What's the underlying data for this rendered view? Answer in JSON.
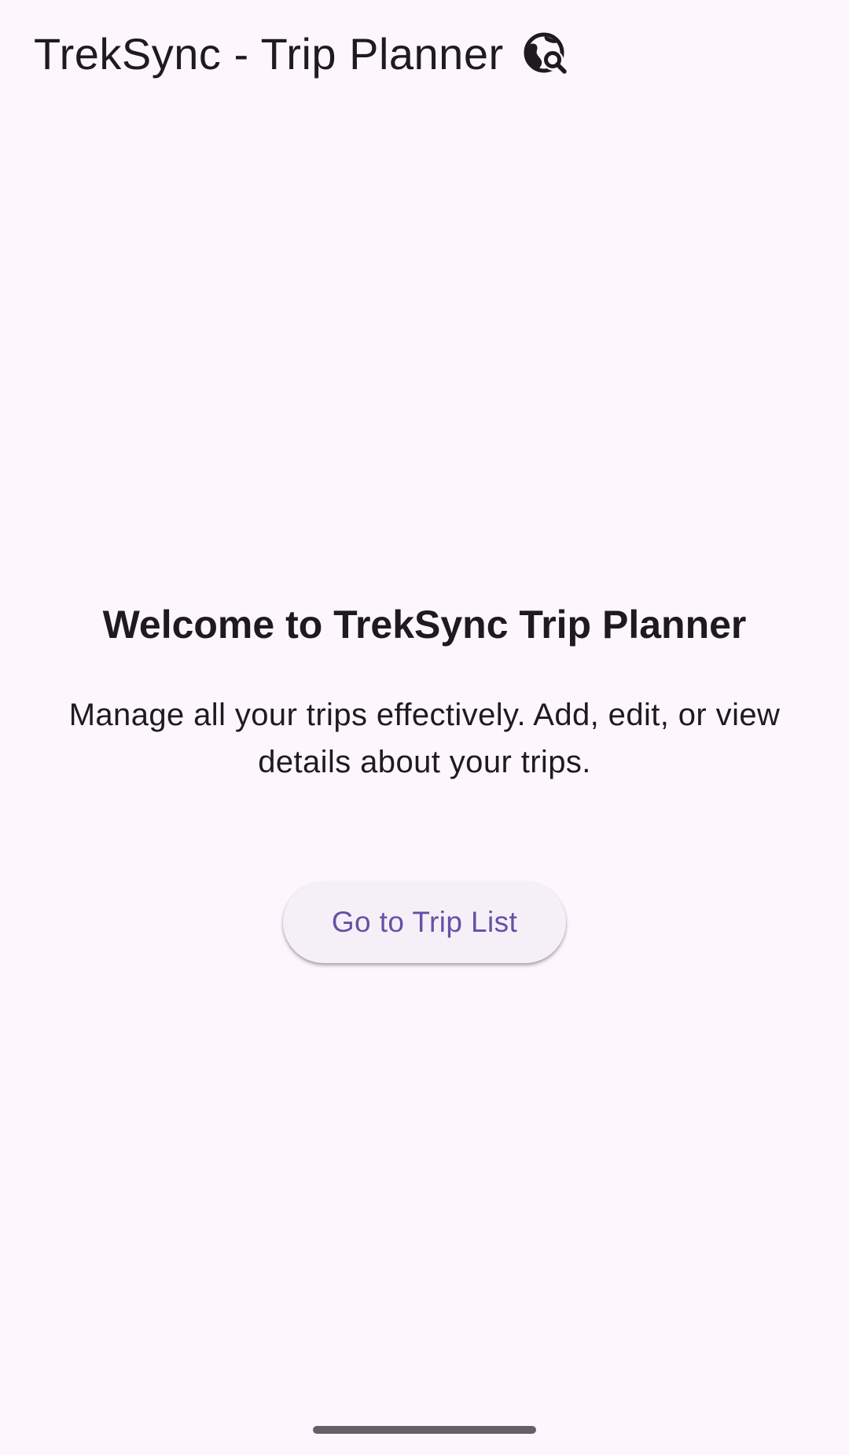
{
  "app_bar": {
    "title": "TrekSync - Trip Planner",
    "icon": "travel-explore-icon"
  },
  "main": {
    "heading": "Welcome to TrekSync Trip Planner",
    "subtitle": "Manage all your trips effectively. Add, edit, or view details about your trips.",
    "button_label": "Go to Trip List"
  },
  "colors": {
    "background": "#fdf7fd",
    "text": "#1d1b20",
    "accent": "#6750a4",
    "button_surface": "#f5f0f8"
  }
}
